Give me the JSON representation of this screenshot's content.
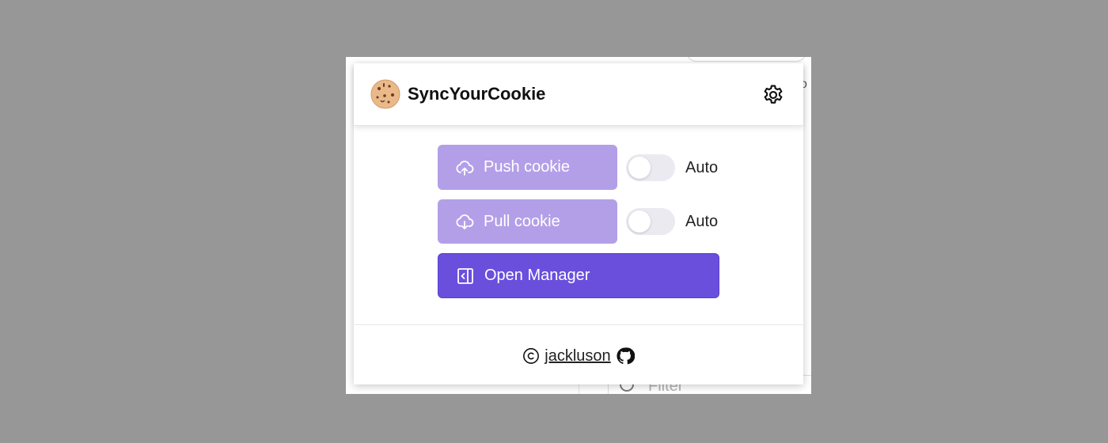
{
  "header": {
    "title": "SyncYourCookie",
    "logo_icon": "cookie-icon",
    "settings_icon": "gear-icon"
  },
  "actions": {
    "push": {
      "label": "Push cookie",
      "icon": "cloud-upload-icon",
      "auto_label": "Auto",
      "auto_enabled": false
    },
    "pull": {
      "label": "Pull cookie",
      "icon": "cloud-download-icon",
      "auto_label": "Auto",
      "auto_enabled": false
    },
    "manager": {
      "label": "Open Manager",
      "icon": "side-panel-icon"
    }
  },
  "footer": {
    "copyright_symbol_icon": "copyright-icon",
    "author": "jackluson",
    "github_icon": "github-icon"
  },
  "background": {
    "filter_placeholder": "Filter"
  },
  "colors": {
    "light_button": "#b39fe8",
    "primary_button": "#6a4fdd",
    "backdrop": "#979797"
  }
}
